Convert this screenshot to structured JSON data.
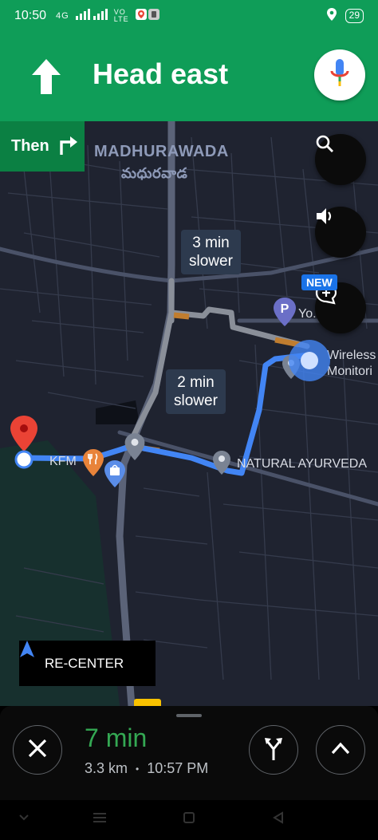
{
  "status_bar": {
    "time": "10:50",
    "network": "4G",
    "volte": "VO LTE",
    "battery": "29"
  },
  "nav": {
    "instruction": "Head east",
    "then_label": "Then"
  },
  "map": {
    "area_name": "MADHURAWADA",
    "area_name_telugu": "మధురవాడ",
    "pois": {
      "kfm": "KFM",
      "ayurveda": "NATURAL AYURVEDA",
      "wireless_line1": "Wireless",
      "wireless_line2": "Monitori",
      "parking": "Yo..."
    },
    "alt_route_1": {
      "line1": "3 min",
      "line2": "slower"
    },
    "alt_route_2": {
      "line1": "2 min",
      "line2": "slower"
    },
    "new_badge": "NEW",
    "recenter_label": "RE-CENTER"
  },
  "trip": {
    "duration": "7 min",
    "distance": "3.3 km",
    "separator": "•",
    "arrival": "10:57 PM"
  },
  "colors": {
    "header_green": "#0f9d58",
    "then_green": "#0b8043",
    "route_blue": "#4285f4",
    "eta_green": "#34a853",
    "map_bg": "#1f2330"
  }
}
